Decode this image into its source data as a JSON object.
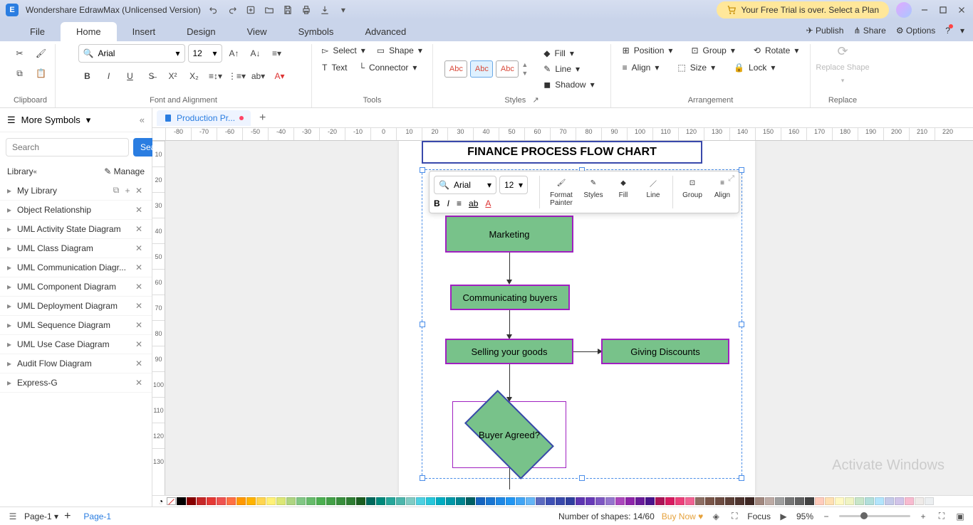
{
  "app": {
    "title": "Wondershare EdrawMax (Unlicensed Version)",
    "trial_banner": "Your Free Trial is over. Select a Plan"
  },
  "menubar": {
    "items": [
      "File",
      "Home",
      "Insert",
      "Design",
      "View",
      "Symbols",
      "Advanced"
    ],
    "active": "Home",
    "right": {
      "publish": "Publish",
      "share": "Share",
      "options": "Options"
    }
  },
  "ribbon": {
    "clipboard": {
      "label": "Clipboard"
    },
    "font": {
      "label": "Font and Alignment",
      "font_name": "Arial",
      "font_size": "12"
    },
    "tools": {
      "label": "Tools",
      "select": "Select",
      "shape": "Shape",
      "text": "Text",
      "connector": "Connector"
    },
    "styles": {
      "label": "Styles",
      "chip": "Abc",
      "fill": "Fill",
      "line": "Line",
      "shadow": "Shadow"
    },
    "arrangement": {
      "label": "Arrangement",
      "position": "Position",
      "group": "Group",
      "rotate": "Rotate",
      "align": "Align",
      "size": "Size",
      "lock": "Lock"
    },
    "replace": {
      "label": "Replace",
      "btn": "Replace Shape"
    }
  },
  "sidebar": {
    "header": "More Symbols",
    "search_placeholder": "Search",
    "search_btn": "Search",
    "library_label": "Library",
    "manage_label": "Manage",
    "items": [
      "My Library",
      "Object Relationship",
      "UML Activity State Diagram",
      "UML Class Diagram",
      "UML Communication Diagr...",
      "UML Component Diagram",
      "UML Deployment Diagram",
      "UML Sequence Diagram",
      "UML Use Case Diagram",
      "Audit Flow Diagram",
      "Express-G"
    ]
  },
  "doc_tabs": {
    "tab1": "Production Pr..."
  },
  "ruler_h": [
    "-80",
    "-70",
    "-60",
    "-50",
    "-40",
    "-30",
    "-20",
    "-10",
    "0",
    "10",
    "20",
    "30",
    "40",
    "50",
    "60",
    "70",
    "80",
    "90",
    "100",
    "110",
    "120",
    "130",
    "140",
    "150",
    "160",
    "170",
    "180",
    "190",
    "200",
    "210",
    "220"
  ],
  "ruler_v": [
    "10",
    "20",
    "30",
    "40",
    "50",
    "60",
    "70",
    "80",
    "90",
    "100",
    "110",
    "120",
    "130"
  ],
  "flowchart": {
    "title": "FINANCE PROCESS FLOW CHART",
    "box1": "Marketing",
    "box2": "Communicating buyers",
    "box3": "Selling your goods",
    "box4": "Giving Discounts",
    "diamond": "Buyer Agreed?"
  },
  "mini_toolbar": {
    "font_name": "Arial",
    "font_size": "12",
    "format_painter": "Format Painter",
    "styles": "Styles",
    "fill": "Fill",
    "line": "Line",
    "group": "Group",
    "align": "Align"
  },
  "palette_colors": [
    "#000000",
    "#870000",
    "#c62828",
    "#e53935",
    "#ef5350",
    "#ff7043",
    "#ff9800",
    "#ffb300",
    "#ffd54f",
    "#fff176",
    "#dce775",
    "#aed581",
    "#81c784",
    "#66bb6a",
    "#4caf50",
    "#43a047",
    "#388e3c",
    "#2e7d32",
    "#1b5e20",
    "#00695c",
    "#00897b",
    "#26a69a",
    "#4db6ac",
    "#80cbc4",
    "#4dd0e1",
    "#26c6da",
    "#00acc1",
    "#0097a7",
    "#00838f",
    "#006064",
    "#1565c0",
    "#1976d2",
    "#1e88e5",
    "#2196f3",
    "#42a5f5",
    "#64b5f6",
    "#5c6bc0",
    "#3f51b5",
    "#3949ab",
    "#303f9f",
    "#5e35b1",
    "#673ab7",
    "#7e57c2",
    "#9575cd",
    "#ab47bc",
    "#8e24aa",
    "#6a1b9a",
    "#4a148c",
    "#ad1457",
    "#d81b60",
    "#ec407a",
    "#f06292",
    "#8d6e63",
    "#795548",
    "#6d4c41",
    "#5d4037",
    "#4e342e",
    "#3e2723",
    "#a1887f",
    "#bcaaa4",
    "#9e9e9e",
    "#757575",
    "#616161",
    "#424242",
    "#ffccbc",
    "#ffe0b2",
    "#fff9c4",
    "#f0f4c3",
    "#c8e6c9",
    "#b2dfdb",
    "#b3e5fc",
    "#c5cae9",
    "#d1c4e9",
    "#f8bbd0",
    "#efebe9",
    "#eceff1"
  ],
  "statusbar": {
    "page_sel": "Page-1",
    "page_tab": "Page-1",
    "shapes": "Number of shapes: 14/60",
    "buy_now": "Buy Now",
    "focus": "Focus",
    "zoom": "95%"
  },
  "watermark": "Activate Windows",
  "chart_data": {
    "type": "flowchart",
    "title": "FINANCE PROCESS FLOW CHART",
    "nodes": [
      {
        "id": "n1",
        "label": "Marketing",
        "shape": "process"
      },
      {
        "id": "n2",
        "label": "Communicating buyers",
        "shape": "process"
      },
      {
        "id": "n3",
        "label": "Selling your goods",
        "shape": "process"
      },
      {
        "id": "n4",
        "label": "Giving Discounts",
        "shape": "process"
      },
      {
        "id": "n5",
        "label": "Buyer Agreed?",
        "shape": "decision"
      }
    ],
    "edges": [
      {
        "from": "n1",
        "to": "n2"
      },
      {
        "from": "n2",
        "to": "n3"
      },
      {
        "from": "n3",
        "to": "n4"
      },
      {
        "from": "n3",
        "to": "n5"
      }
    ]
  }
}
